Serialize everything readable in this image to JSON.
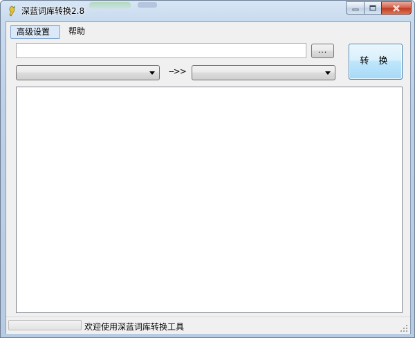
{
  "window": {
    "title": "深蓝词库转换2.8",
    "caption_buttons": [
      "minimize-icon",
      "maximize-icon",
      "close-icon"
    ]
  },
  "menu": {
    "items": [
      {
        "label": "高级设置",
        "active": true
      },
      {
        "label": "帮助",
        "active": false
      }
    ]
  },
  "toolbar": {
    "path_value": "",
    "browse_label": "...",
    "convert_label": "转 换",
    "source_format": "",
    "target_format": "",
    "arrow_text": "-->>"
  },
  "log": {
    "content": ""
  },
  "status": {
    "progress": 0,
    "text": "欢迎使用深蓝词库转换工具"
  },
  "colors": {
    "accent": "#3c7fb1",
    "menu_highlight": "#dbe8f8",
    "close_button": "#c23a23"
  }
}
